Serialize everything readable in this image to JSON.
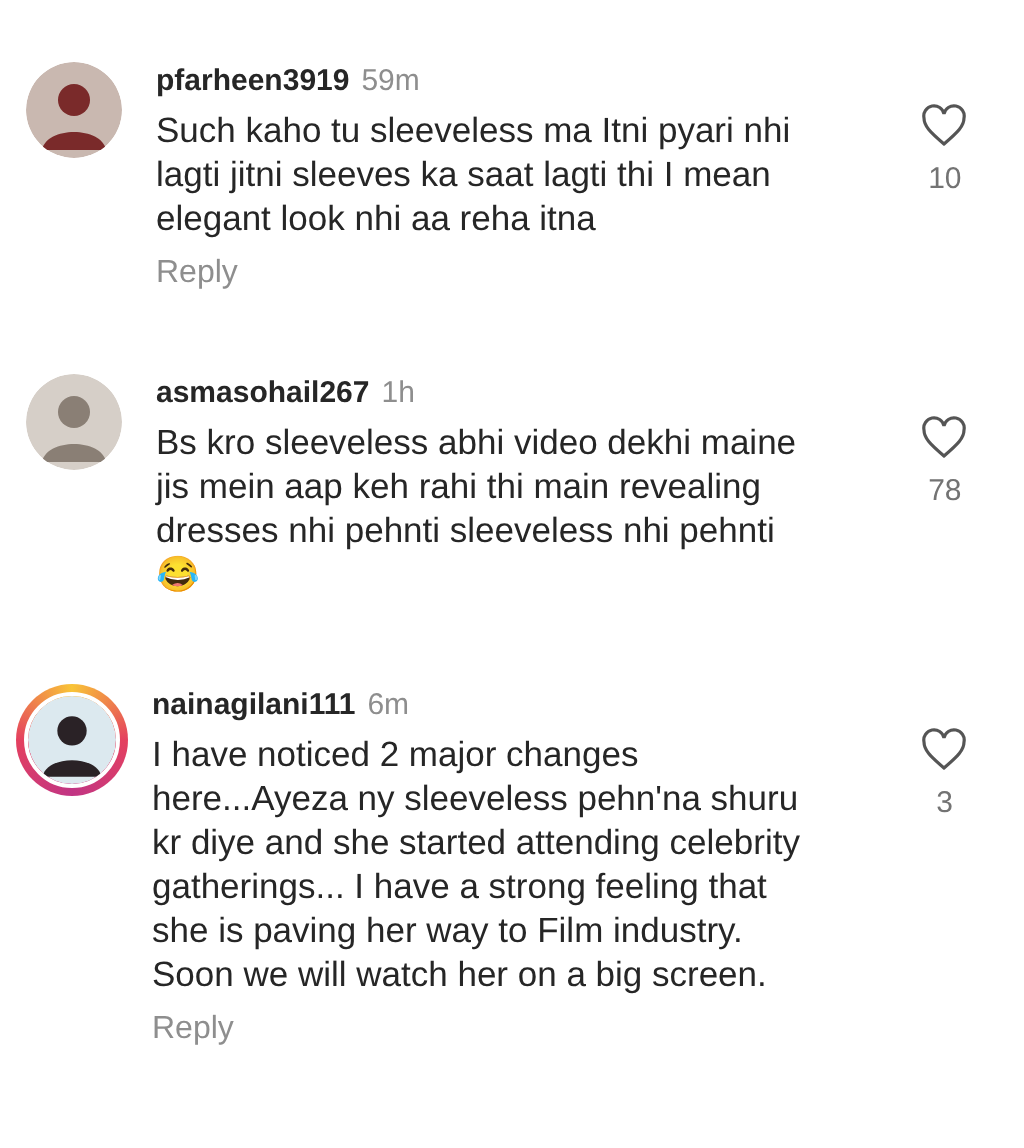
{
  "comments": [
    {
      "username": "pfarheen3919",
      "time": "59m",
      "text": "Such kaho tu sleeveless ma Itni pyari nhi lagti jitni sleeves ka saat lagti thi I mean elegant look nhi aa reha itna",
      "likes": "10",
      "reply": "Reply",
      "story_ring": false,
      "liked": false
    },
    {
      "username": "asmasohail267",
      "time": "1h",
      "text": "Bs kro sleeveless abhi video dekhi maine jis mein aap keh rahi thi main revealing dresses nhi pehnti sleeveless nhi pehnti 😂",
      "likes": "78",
      "story_ring": false,
      "liked": false
    },
    {
      "username": "nainagilani111",
      "time": "6m",
      "text": "I have noticed 2 major changes here...Ayeza ny sleeveless pehn'na shuru kr diye and she started attending celebrity gatherings... I have a strong feeling that she is paving her way to Film industry. Soon we will watch her on a big screen.",
      "likes": "3",
      "reply": "Reply",
      "story_ring": true,
      "liked": false
    }
  ]
}
